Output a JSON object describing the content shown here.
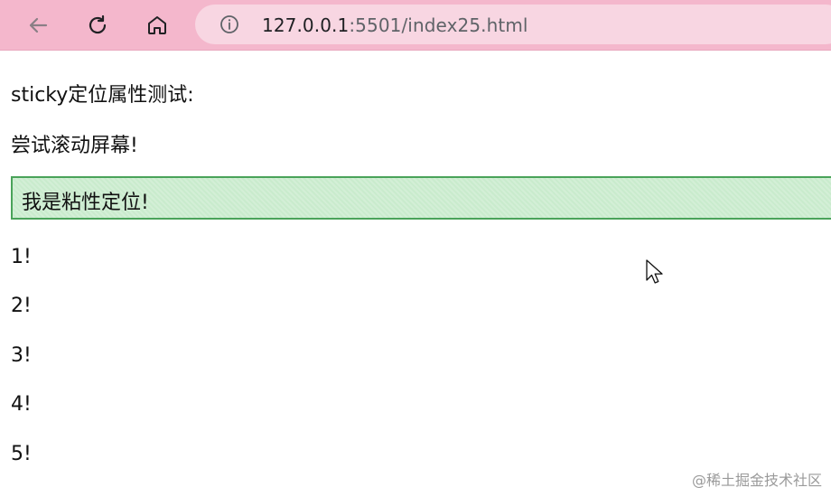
{
  "browser": {
    "url_host": "127.0.0.1",
    "url_rest": ":5501/index25.html",
    "icons": {
      "back": "back-arrow-icon",
      "reload": "reload-icon",
      "home": "home-icon",
      "info": "info-icon"
    },
    "colors": {
      "bar": "#f4b7cc",
      "address": "#f8d6e2"
    }
  },
  "page": {
    "line1": "sticky定位属性测试:",
    "line2": "尝试滚动屏幕!",
    "sticky_label": "我是粘性定位!",
    "items": [
      "1!",
      "2!",
      "3!",
      "4!",
      "5!"
    ],
    "watermark": "@稀土掘金技术社区",
    "colors": {
      "sticky_bg": "#c9ebcd",
      "sticky_border": "#4aa35a"
    }
  },
  "cursor": {
    "icon": "mouse-pointer-icon"
  }
}
